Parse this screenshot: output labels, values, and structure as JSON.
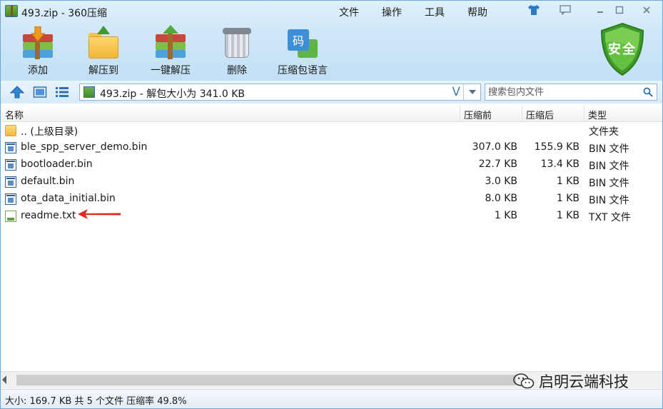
{
  "window": {
    "title": "493.zip - 360压缩"
  },
  "menu": {
    "file": "文件",
    "operate": "操作",
    "tools": "工具",
    "help": "帮助"
  },
  "toolbar": {
    "add": "添加",
    "extract_to": "解压到",
    "one_click_extract": "一键解压",
    "delete": "删除",
    "language_pack": "压缩包语言"
  },
  "security_badge": "安全",
  "address": {
    "path": "493.zip - 解包大小为 341.0 KB",
    "v_glyph": "V"
  },
  "search": {
    "placeholder": "搜索包内文件"
  },
  "columns": {
    "name": "名称",
    "size_before": "压缩前",
    "size_after": "压缩后",
    "type": "类型"
  },
  "files": [
    {
      "name": ".. (上级目录)",
      "size_before": "",
      "size_after": "",
      "type": "文件夹",
      "icon": "folder-icon"
    },
    {
      "name": "ble_spp_server_demo.bin",
      "size_before": "307.0 KB",
      "size_after": "155.9 KB",
      "type": "BIN 文件",
      "icon": "bin-file-icon"
    },
    {
      "name": "bootloader.bin",
      "size_before": "22.7 KB",
      "size_after": "13.4 KB",
      "type": "BIN 文件",
      "icon": "bin-file-icon"
    },
    {
      "name": "default.bin",
      "size_before": "3.0 KB",
      "size_after": "1 KB",
      "type": "BIN 文件",
      "icon": "bin-file-icon"
    },
    {
      "name": "ota_data_initial.bin",
      "size_before": "8.0 KB",
      "size_after": "1 KB",
      "type": "BIN 文件",
      "icon": "bin-file-icon"
    },
    {
      "name": "readme.txt",
      "size_before": "1 KB",
      "size_after": "1 KB",
      "type": "TXT 文件",
      "icon": "txt-file-icon"
    }
  ],
  "status": {
    "text": "大小: 169.7 KB 共 5 个文件 压缩率 49.8%"
  },
  "watermark": {
    "text": "启明云端科技"
  },
  "colors": {
    "toolbar_bg": "#cfe7f8",
    "shield_green": "#4caf2f",
    "annotation_arrow": "#e02a1f"
  }
}
